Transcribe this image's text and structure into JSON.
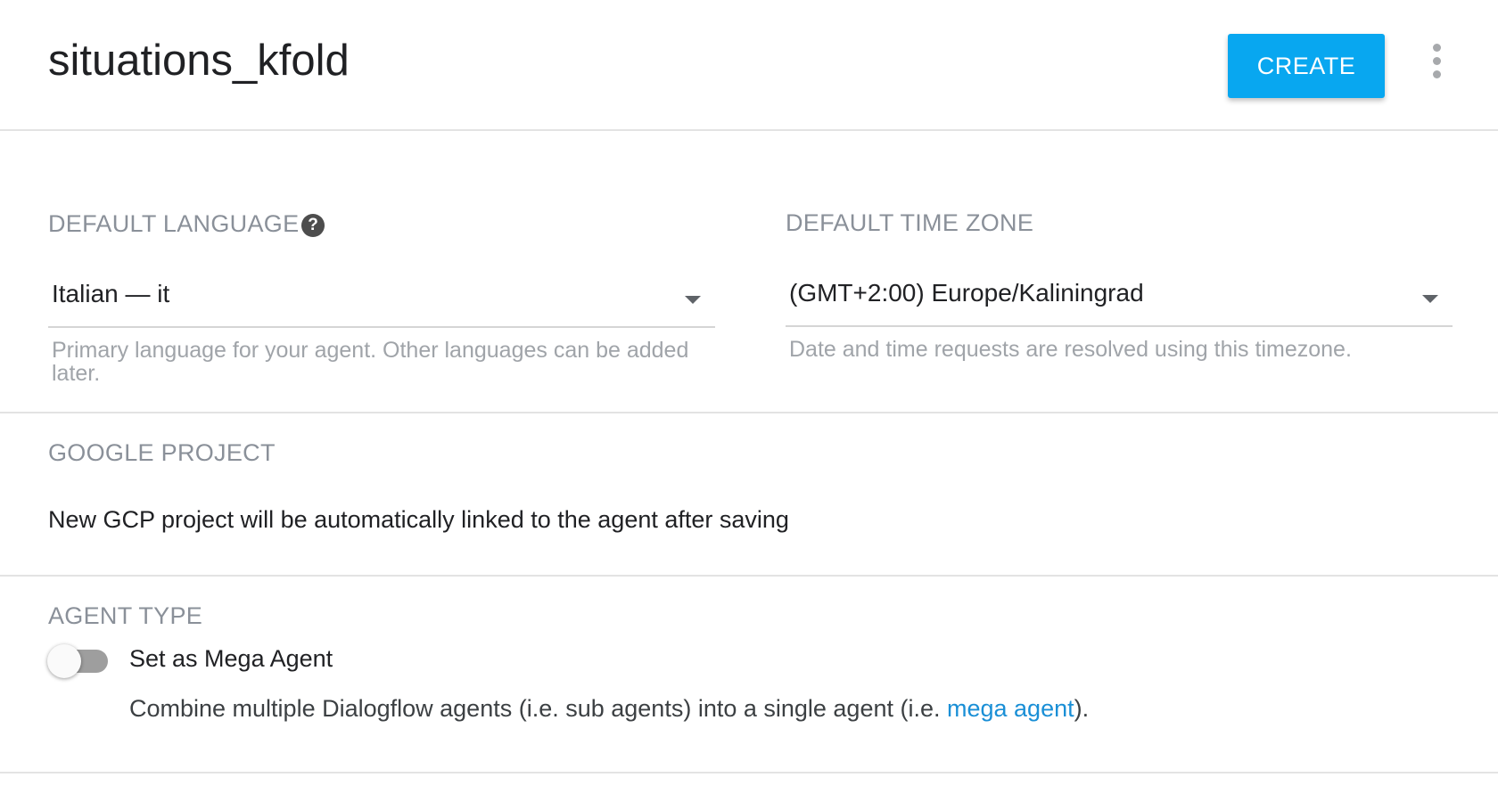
{
  "header": {
    "agent_name": "situations_kfold",
    "create_label": "CREATE",
    "more_icon": "more-vert-icon"
  },
  "language": {
    "label": "DEFAULT LANGUAGE",
    "help_icon": "help-circle-icon",
    "help_glyph": "?",
    "value": "Italian — it",
    "hint_line1": "Primary language for your agent. Other languages can be added",
    "hint_line2": "later."
  },
  "timezone": {
    "label": "DEFAULT TIME ZONE",
    "value": "(GMT+2:00) Europe/Kaliningrad",
    "hint": "Date and time requests are resolved using this timezone."
  },
  "google_project": {
    "label": "GOOGLE PROJECT",
    "text": "New GCP project will be automatically linked to the agent after saving"
  },
  "agent_type": {
    "label": "AGENT TYPE",
    "toggle_label": "Set as Mega Agent",
    "toggle_on": false,
    "desc_prefix": "Combine multiple Dialogflow agents (i.e. sub agents) into a single agent (i.e. ",
    "desc_link": "mega agent",
    "desc_suffix": ")."
  },
  "colors": {
    "accent": "#08a7f0",
    "link": "#1a8fd6",
    "label_gray": "#8a9099"
  }
}
